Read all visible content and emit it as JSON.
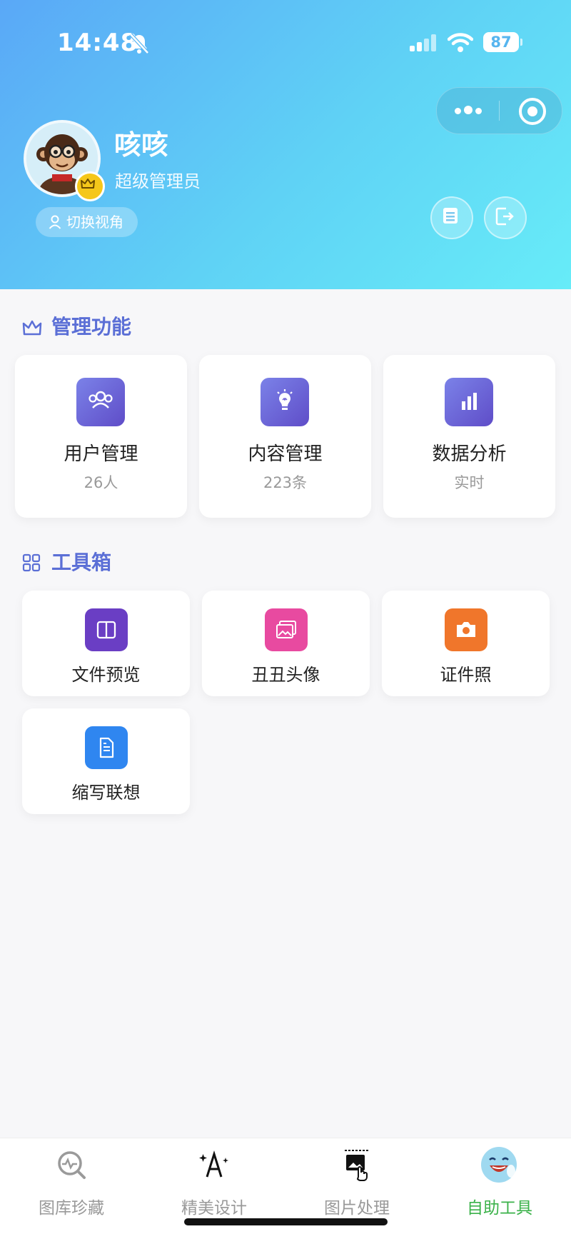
{
  "status_bar": {
    "time": "14:48",
    "battery": "87"
  },
  "profile": {
    "name": "咳咳",
    "role": "超级管理员",
    "switch_view_label": "切换视角"
  },
  "management": {
    "title": "管理功能",
    "cards": [
      {
        "label": "用户管理",
        "sub": "26人",
        "icon": "users-icon"
      },
      {
        "label": "内容管理",
        "sub": "223条",
        "icon": "bulb-icon"
      },
      {
        "label": "数据分析",
        "sub": "实时",
        "icon": "bar-chart-icon"
      }
    ]
  },
  "toolbox": {
    "title": "工具箱",
    "items": [
      {
        "label": "文件预览",
        "icon": "book-icon",
        "color": "#6a3ec4"
      },
      {
        "label": "丑丑头像",
        "icon": "image-stack-icon",
        "color": "#e84aa0"
      },
      {
        "label": "证件照",
        "icon": "camera-icon",
        "color": "#f0762b"
      },
      {
        "label": "缩写联想",
        "icon": "document-icon",
        "color": "#2f86f0"
      }
    ]
  },
  "tabbar": {
    "tabs": [
      {
        "label": "图库珍藏",
        "icon": "gallery-search-icon",
        "active": false
      },
      {
        "label": "精美设计",
        "icon": "sparkle-a-icon",
        "active": false
      },
      {
        "label": "图片处理",
        "icon": "image-hand-icon",
        "active": false
      },
      {
        "label": "自助工具",
        "icon": "laughing-face-icon",
        "active": true
      }
    ]
  },
  "colors": {
    "accent_title": "#5b6fd6",
    "active_tab": "#3bb24a",
    "mgmt_icon": "#6b5bd6"
  }
}
